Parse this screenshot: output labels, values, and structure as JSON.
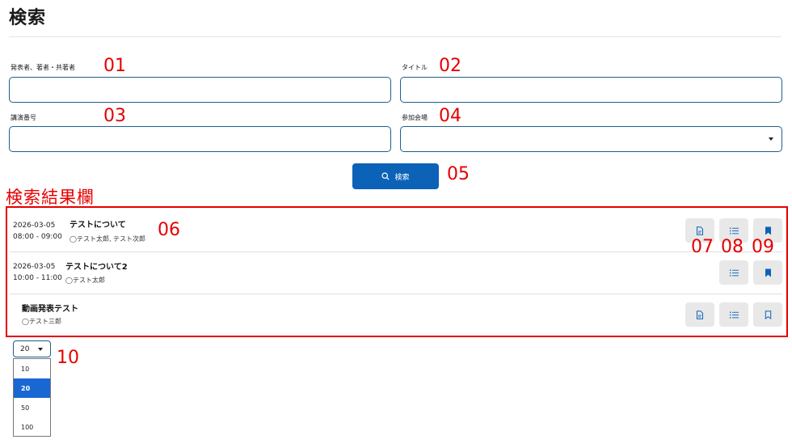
{
  "page": {
    "title": "検索"
  },
  "form": {
    "authors_label": "発表者、著者・共著者",
    "title_label": "タイトル",
    "lecture_no_label": "講演番号",
    "venue_label": "参加会場",
    "search_button": "検索"
  },
  "annotations": [
    "01",
    "02",
    "03",
    "04",
    "05",
    "06",
    "07",
    "08",
    "09",
    "10"
  ],
  "results": {
    "heading": "検索結果欄",
    "items": [
      {
        "date": "2026-03-05",
        "time": "08:00 - 09:00",
        "title": "テストについて",
        "authors": "◯テスト太郎, テスト次郎",
        "buttons": [
          "document-icon",
          "list-icon",
          "bookmark-filled-icon"
        ]
      },
      {
        "date": "2026-03-05",
        "time": "10:00 - 11:00",
        "title": "テストについて2",
        "authors": "◯テスト太郎",
        "buttons": [
          "list-icon",
          "bookmark-filled-icon"
        ]
      },
      {
        "date": "",
        "time": "",
        "title": "動画発表テスト",
        "authors": "◯テスト三郎",
        "buttons": [
          "document-icon",
          "list-icon",
          "bookmark-outline-icon"
        ]
      }
    ]
  },
  "pagination": {
    "selected": "20",
    "options": [
      "10",
      "20",
      "50",
      "100"
    ]
  },
  "colors": {
    "primary": "#0b62b7",
    "annotation": "#e60000",
    "icon": "#0b62b7"
  }
}
